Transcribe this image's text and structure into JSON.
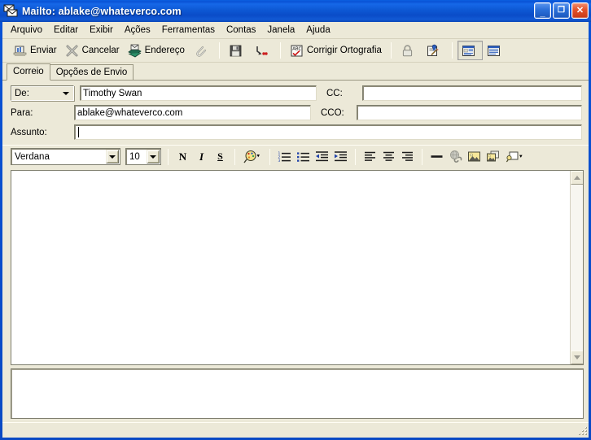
{
  "window": {
    "title_prefix": "Mailto:",
    "title_address": "ablake@whateverco.com",
    "icon": "mail-envelope-icon",
    "minimize_label": "_",
    "maximize_label": "□",
    "close_label": "✕",
    "titlebar_color": "#0a53d6",
    "client_color": "#ece9d8"
  },
  "menu": {
    "items": [
      {
        "label": "Arquivo"
      },
      {
        "label": "Editar"
      },
      {
        "label": "Exibir"
      },
      {
        "label": "Ações"
      },
      {
        "label": "Ferramentas"
      },
      {
        "label": "Contas"
      },
      {
        "label": "Janela"
      },
      {
        "label": "Ajuda"
      }
    ]
  },
  "toolbar": {
    "send_label": "Enviar",
    "cancel_label": "Cancelar",
    "address_label": "Endereço",
    "attach_label": "",
    "save_label": "",
    "send_later_label": "",
    "spell_label": "Corrigir Ortografia",
    "encrypt_label": "",
    "sign_label": "",
    "view_html_label": "",
    "view_plain_label": ""
  },
  "tabs": {
    "items": [
      {
        "label": "Correio",
        "active": true
      },
      {
        "label": "Opções de Envio",
        "active": false
      }
    ]
  },
  "fields": {
    "from_label": "De:",
    "from_value": "Timothy Swan",
    "to_label": "Para:",
    "to_value": "ablake@whateverco.com",
    "subject_label": "Assunto:",
    "subject_value": "",
    "cc_label": "CC:",
    "cc_value": "",
    "bcc_label": "CCO:",
    "bcc_value": ""
  },
  "format_toolbar": {
    "font_family": "Verdana",
    "font_size": "10",
    "bold_label": "N",
    "italic_label": "I",
    "underline_label": "S",
    "font_color_label": "",
    "numbered_list_label": "",
    "bullet_list_label": "",
    "decrease_indent_label": "",
    "increase_indent_label": "",
    "align_left_label": "",
    "align_center_label": "",
    "align_right_label": "",
    "horizontal_rule_label": "",
    "insert_link_label": "",
    "insert_image_label": "",
    "background_image_label": "",
    "insert_object_label": ""
  },
  "body": {
    "content": ""
  },
  "attachment_pane": {
    "content": ""
  },
  "status_bar": {
    "text": ""
  }
}
